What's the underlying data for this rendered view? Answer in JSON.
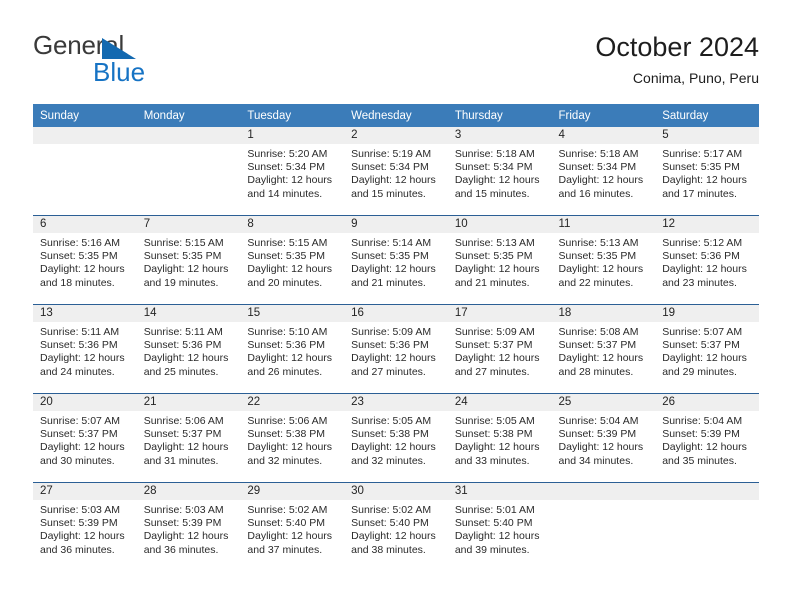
{
  "brand": {
    "name_top": "General",
    "name_bottom": "Blue",
    "logo_color": "#1369b0",
    "text_color": "#3a3a3a"
  },
  "header": {
    "title": "October 2024",
    "subtitle": "Conima, Puno, Peru"
  },
  "theme": {
    "header_row_bg": "#3b7cb9",
    "header_row_text": "#ffffff",
    "daynum_band_bg": "#efefef",
    "row_divider": "#2b5f95"
  },
  "weekday_headers": [
    "Sunday",
    "Monday",
    "Tuesday",
    "Wednesday",
    "Thursday",
    "Friday",
    "Saturday"
  ],
  "labels": {
    "sunrise_prefix": "Sunrise:",
    "sunset_prefix": "Sunset:",
    "daylight_prefix": "Daylight:"
  },
  "weeks": [
    [
      {
        "day": "",
        "empty": true,
        "sunrise": "",
        "sunset": "",
        "daylight_line1": "",
        "daylight_line2": ""
      },
      {
        "day": "",
        "empty": true,
        "sunrise": "",
        "sunset": "",
        "daylight_line1": "",
        "daylight_line2": ""
      },
      {
        "day": "1",
        "empty": false,
        "sunrise": "Sunrise: 5:20 AM",
        "sunset": "Sunset: 5:34 PM",
        "daylight_line1": "Daylight: 12 hours",
        "daylight_line2": "and 14 minutes."
      },
      {
        "day": "2",
        "empty": false,
        "sunrise": "Sunrise: 5:19 AM",
        "sunset": "Sunset: 5:34 PM",
        "daylight_line1": "Daylight: 12 hours",
        "daylight_line2": "and 15 minutes."
      },
      {
        "day": "3",
        "empty": false,
        "sunrise": "Sunrise: 5:18 AM",
        "sunset": "Sunset: 5:34 PM",
        "daylight_line1": "Daylight: 12 hours",
        "daylight_line2": "and 15 minutes."
      },
      {
        "day": "4",
        "empty": false,
        "sunrise": "Sunrise: 5:18 AM",
        "sunset": "Sunset: 5:34 PM",
        "daylight_line1": "Daylight: 12 hours",
        "daylight_line2": "and 16 minutes."
      },
      {
        "day": "5",
        "empty": false,
        "sunrise": "Sunrise: 5:17 AM",
        "sunset": "Sunset: 5:35 PM",
        "daylight_line1": "Daylight: 12 hours",
        "daylight_line2": "and 17 minutes."
      }
    ],
    [
      {
        "day": "6",
        "empty": false,
        "sunrise": "Sunrise: 5:16 AM",
        "sunset": "Sunset: 5:35 PM",
        "daylight_line1": "Daylight: 12 hours",
        "daylight_line2": "and 18 minutes."
      },
      {
        "day": "7",
        "empty": false,
        "sunrise": "Sunrise: 5:15 AM",
        "sunset": "Sunset: 5:35 PM",
        "daylight_line1": "Daylight: 12 hours",
        "daylight_line2": "and 19 minutes."
      },
      {
        "day": "8",
        "empty": false,
        "sunrise": "Sunrise: 5:15 AM",
        "sunset": "Sunset: 5:35 PM",
        "daylight_line1": "Daylight: 12 hours",
        "daylight_line2": "and 20 minutes."
      },
      {
        "day": "9",
        "empty": false,
        "sunrise": "Sunrise: 5:14 AM",
        "sunset": "Sunset: 5:35 PM",
        "daylight_line1": "Daylight: 12 hours",
        "daylight_line2": "and 21 minutes."
      },
      {
        "day": "10",
        "empty": false,
        "sunrise": "Sunrise: 5:13 AM",
        "sunset": "Sunset: 5:35 PM",
        "daylight_line1": "Daylight: 12 hours",
        "daylight_line2": "and 21 minutes."
      },
      {
        "day": "11",
        "empty": false,
        "sunrise": "Sunrise: 5:13 AM",
        "sunset": "Sunset: 5:35 PM",
        "daylight_line1": "Daylight: 12 hours",
        "daylight_line2": "and 22 minutes."
      },
      {
        "day": "12",
        "empty": false,
        "sunrise": "Sunrise: 5:12 AM",
        "sunset": "Sunset: 5:36 PM",
        "daylight_line1": "Daylight: 12 hours",
        "daylight_line2": "and 23 minutes."
      }
    ],
    [
      {
        "day": "13",
        "empty": false,
        "sunrise": "Sunrise: 5:11 AM",
        "sunset": "Sunset: 5:36 PM",
        "daylight_line1": "Daylight: 12 hours",
        "daylight_line2": "and 24 minutes."
      },
      {
        "day": "14",
        "empty": false,
        "sunrise": "Sunrise: 5:11 AM",
        "sunset": "Sunset: 5:36 PM",
        "daylight_line1": "Daylight: 12 hours",
        "daylight_line2": "and 25 minutes."
      },
      {
        "day": "15",
        "empty": false,
        "sunrise": "Sunrise: 5:10 AM",
        "sunset": "Sunset: 5:36 PM",
        "daylight_line1": "Daylight: 12 hours",
        "daylight_line2": "and 26 minutes."
      },
      {
        "day": "16",
        "empty": false,
        "sunrise": "Sunrise: 5:09 AM",
        "sunset": "Sunset: 5:36 PM",
        "daylight_line1": "Daylight: 12 hours",
        "daylight_line2": "and 27 minutes."
      },
      {
        "day": "17",
        "empty": false,
        "sunrise": "Sunrise: 5:09 AM",
        "sunset": "Sunset: 5:37 PM",
        "daylight_line1": "Daylight: 12 hours",
        "daylight_line2": "and 27 minutes."
      },
      {
        "day": "18",
        "empty": false,
        "sunrise": "Sunrise: 5:08 AM",
        "sunset": "Sunset: 5:37 PM",
        "daylight_line1": "Daylight: 12 hours",
        "daylight_line2": "and 28 minutes."
      },
      {
        "day": "19",
        "empty": false,
        "sunrise": "Sunrise: 5:07 AM",
        "sunset": "Sunset: 5:37 PM",
        "daylight_line1": "Daylight: 12 hours",
        "daylight_line2": "and 29 minutes."
      }
    ],
    [
      {
        "day": "20",
        "empty": false,
        "sunrise": "Sunrise: 5:07 AM",
        "sunset": "Sunset: 5:37 PM",
        "daylight_line1": "Daylight: 12 hours",
        "daylight_line2": "and 30 minutes."
      },
      {
        "day": "21",
        "empty": false,
        "sunrise": "Sunrise: 5:06 AM",
        "sunset": "Sunset: 5:37 PM",
        "daylight_line1": "Daylight: 12 hours",
        "daylight_line2": "and 31 minutes."
      },
      {
        "day": "22",
        "empty": false,
        "sunrise": "Sunrise: 5:06 AM",
        "sunset": "Sunset: 5:38 PM",
        "daylight_line1": "Daylight: 12 hours",
        "daylight_line2": "and 32 minutes."
      },
      {
        "day": "23",
        "empty": false,
        "sunrise": "Sunrise: 5:05 AM",
        "sunset": "Sunset: 5:38 PM",
        "daylight_line1": "Daylight: 12 hours",
        "daylight_line2": "and 32 minutes."
      },
      {
        "day": "24",
        "empty": false,
        "sunrise": "Sunrise: 5:05 AM",
        "sunset": "Sunset: 5:38 PM",
        "daylight_line1": "Daylight: 12 hours",
        "daylight_line2": "and 33 minutes."
      },
      {
        "day": "25",
        "empty": false,
        "sunrise": "Sunrise: 5:04 AM",
        "sunset": "Sunset: 5:39 PM",
        "daylight_line1": "Daylight: 12 hours",
        "daylight_line2": "and 34 minutes."
      },
      {
        "day": "26",
        "empty": false,
        "sunrise": "Sunrise: 5:04 AM",
        "sunset": "Sunset: 5:39 PM",
        "daylight_line1": "Daylight: 12 hours",
        "daylight_line2": "and 35 minutes."
      }
    ],
    [
      {
        "day": "27",
        "empty": false,
        "sunrise": "Sunrise: 5:03 AM",
        "sunset": "Sunset: 5:39 PM",
        "daylight_line1": "Daylight: 12 hours",
        "daylight_line2": "and 36 minutes."
      },
      {
        "day": "28",
        "empty": false,
        "sunrise": "Sunrise: 5:03 AM",
        "sunset": "Sunset: 5:39 PM",
        "daylight_line1": "Daylight: 12 hours",
        "daylight_line2": "and 36 minutes."
      },
      {
        "day": "29",
        "empty": false,
        "sunrise": "Sunrise: 5:02 AM",
        "sunset": "Sunset: 5:40 PM",
        "daylight_line1": "Daylight: 12 hours",
        "daylight_line2": "and 37 minutes."
      },
      {
        "day": "30",
        "empty": false,
        "sunrise": "Sunrise: 5:02 AM",
        "sunset": "Sunset: 5:40 PM",
        "daylight_line1": "Daylight: 12 hours",
        "daylight_line2": "and 38 minutes."
      },
      {
        "day": "31",
        "empty": false,
        "sunrise": "Sunrise: 5:01 AM",
        "sunset": "Sunset: 5:40 PM",
        "daylight_line1": "Daylight: 12 hours",
        "daylight_line2": "and 39 minutes."
      },
      {
        "day": "",
        "empty": true,
        "sunrise": "",
        "sunset": "",
        "daylight_line1": "",
        "daylight_line2": ""
      },
      {
        "day": "",
        "empty": true,
        "sunrise": "",
        "sunset": "",
        "daylight_line1": "",
        "daylight_line2": ""
      }
    ]
  ]
}
